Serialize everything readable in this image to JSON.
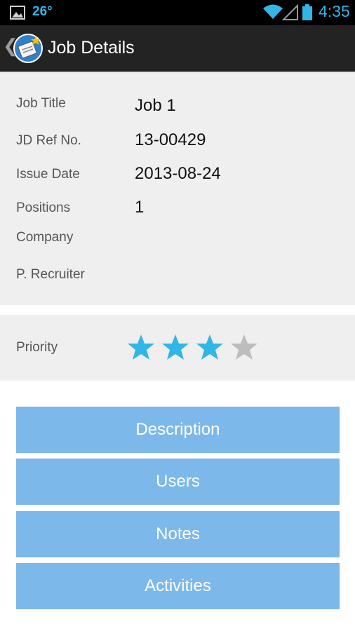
{
  "status_bar": {
    "temperature": "26°",
    "time": "4:35",
    "icons": [
      "image-icon",
      "wifi-icon",
      "signal-icon",
      "battery-icon"
    ]
  },
  "action_bar": {
    "title": "Job Details",
    "back_icon": "chevron-left-icon",
    "app_icon": "app-logo-icon"
  },
  "details": {
    "job_title_label": "Job Title",
    "job_title_value": "Job 1",
    "jd_ref_label": "JD Ref No.",
    "jd_ref_value": "13-00429",
    "issue_date_label": "Issue Date",
    "issue_date_value": "2013-08-24",
    "positions_label": "Positions",
    "positions_value": "1",
    "company_label": "Company",
    "company_value": "",
    "recruiter_label": "P. Recruiter",
    "recruiter_value": ""
  },
  "priority": {
    "label": "Priority",
    "rating": 3,
    "max": 5
  },
  "buttons": {
    "description": "Description",
    "users": "Users",
    "notes": "Notes",
    "activities": "Activities"
  },
  "colors": {
    "accent": "#33b5e5",
    "button_bg": "#7cb8ea",
    "star_filled": "#33b5e5",
    "star_empty": "#bdbdbd"
  }
}
